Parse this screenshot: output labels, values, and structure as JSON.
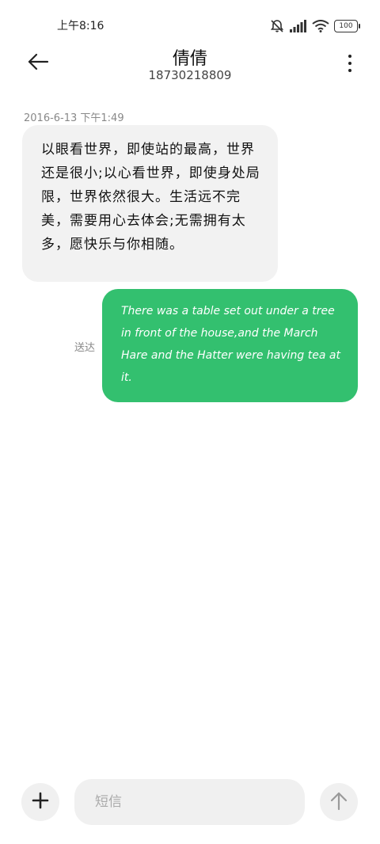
{
  "status_bar": {
    "time": "上午8:16",
    "battery_level": "100",
    "icons": [
      "mute-notification-icon",
      "signal-icon",
      "wifi-icon",
      "battery-icon"
    ]
  },
  "header": {
    "back_icon": "arrow-left-icon",
    "contact_name": "倩倩",
    "contact_number": "18730218809",
    "more_icon": "vertical-dots-icon"
  },
  "messages": [
    {
      "direction": "incoming",
      "timestamp": "2016-6-13 下午1:49",
      "text": "以眼看世界，即使站的最高，世界还是很小;以心看世界，即使身处局限，世界依然很大。生活远不完美，需要用心去体会;无需拥有太多，愿快乐与你相随。"
    },
    {
      "direction": "outgoing",
      "status": "送达",
      "text": "There was a table set out under a tree in front of the house,and the March Hare and the Hatter were having tea at it."
    }
  ],
  "composer": {
    "add_icon": "plus-icon",
    "placeholder": "短信",
    "send_icon": "arrow-up-icon"
  },
  "colors": {
    "outgoing_bubble": "#33c06f",
    "incoming_bubble": "#f2f2f2",
    "background": "#ffffff"
  }
}
